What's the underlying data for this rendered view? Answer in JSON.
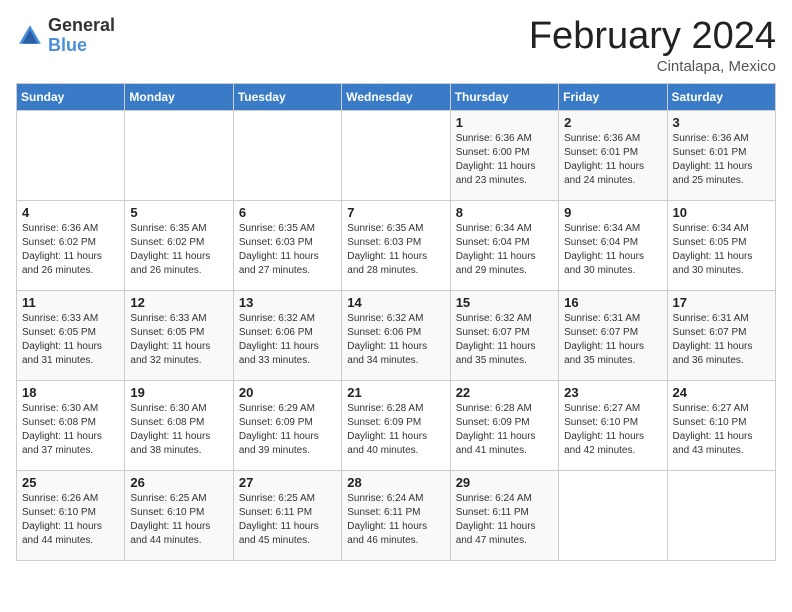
{
  "header": {
    "logo_general": "General",
    "logo_blue": "Blue",
    "month_title": "February 2024",
    "location": "Cintalapa, Mexico"
  },
  "weekdays": [
    "Sunday",
    "Monday",
    "Tuesday",
    "Wednesday",
    "Thursday",
    "Friday",
    "Saturday"
  ],
  "weeks": [
    [
      {
        "day": "",
        "info": ""
      },
      {
        "day": "",
        "info": ""
      },
      {
        "day": "",
        "info": ""
      },
      {
        "day": "",
        "info": ""
      },
      {
        "day": "1",
        "info": "Sunrise: 6:36 AM\nSunset: 6:00 PM\nDaylight: 11 hours\nand 23 minutes."
      },
      {
        "day": "2",
        "info": "Sunrise: 6:36 AM\nSunset: 6:01 PM\nDaylight: 11 hours\nand 24 minutes."
      },
      {
        "day": "3",
        "info": "Sunrise: 6:36 AM\nSunset: 6:01 PM\nDaylight: 11 hours\nand 25 minutes."
      }
    ],
    [
      {
        "day": "4",
        "info": "Sunrise: 6:36 AM\nSunset: 6:02 PM\nDaylight: 11 hours\nand 26 minutes."
      },
      {
        "day": "5",
        "info": "Sunrise: 6:35 AM\nSunset: 6:02 PM\nDaylight: 11 hours\nand 26 minutes."
      },
      {
        "day": "6",
        "info": "Sunrise: 6:35 AM\nSunset: 6:03 PM\nDaylight: 11 hours\nand 27 minutes."
      },
      {
        "day": "7",
        "info": "Sunrise: 6:35 AM\nSunset: 6:03 PM\nDaylight: 11 hours\nand 28 minutes."
      },
      {
        "day": "8",
        "info": "Sunrise: 6:34 AM\nSunset: 6:04 PM\nDaylight: 11 hours\nand 29 minutes."
      },
      {
        "day": "9",
        "info": "Sunrise: 6:34 AM\nSunset: 6:04 PM\nDaylight: 11 hours\nand 30 minutes."
      },
      {
        "day": "10",
        "info": "Sunrise: 6:34 AM\nSunset: 6:05 PM\nDaylight: 11 hours\nand 30 minutes."
      }
    ],
    [
      {
        "day": "11",
        "info": "Sunrise: 6:33 AM\nSunset: 6:05 PM\nDaylight: 11 hours\nand 31 minutes."
      },
      {
        "day": "12",
        "info": "Sunrise: 6:33 AM\nSunset: 6:05 PM\nDaylight: 11 hours\nand 32 minutes."
      },
      {
        "day": "13",
        "info": "Sunrise: 6:32 AM\nSunset: 6:06 PM\nDaylight: 11 hours\nand 33 minutes."
      },
      {
        "day": "14",
        "info": "Sunrise: 6:32 AM\nSunset: 6:06 PM\nDaylight: 11 hours\nand 34 minutes."
      },
      {
        "day": "15",
        "info": "Sunrise: 6:32 AM\nSunset: 6:07 PM\nDaylight: 11 hours\nand 35 minutes."
      },
      {
        "day": "16",
        "info": "Sunrise: 6:31 AM\nSunset: 6:07 PM\nDaylight: 11 hours\nand 35 minutes."
      },
      {
        "day": "17",
        "info": "Sunrise: 6:31 AM\nSunset: 6:07 PM\nDaylight: 11 hours\nand 36 minutes."
      }
    ],
    [
      {
        "day": "18",
        "info": "Sunrise: 6:30 AM\nSunset: 6:08 PM\nDaylight: 11 hours\nand 37 minutes."
      },
      {
        "day": "19",
        "info": "Sunrise: 6:30 AM\nSunset: 6:08 PM\nDaylight: 11 hours\nand 38 minutes."
      },
      {
        "day": "20",
        "info": "Sunrise: 6:29 AM\nSunset: 6:09 PM\nDaylight: 11 hours\nand 39 minutes."
      },
      {
        "day": "21",
        "info": "Sunrise: 6:28 AM\nSunset: 6:09 PM\nDaylight: 11 hours\nand 40 minutes."
      },
      {
        "day": "22",
        "info": "Sunrise: 6:28 AM\nSunset: 6:09 PM\nDaylight: 11 hours\nand 41 minutes."
      },
      {
        "day": "23",
        "info": "Sunrise: 6:27 AM\nSunset: 6:10 PM\nDaylight: 11 hours\nand 42 minutes."
      },
      {
        "day": "24",
        "info": "Sunrise: 6:27 AM\nSunset: 6:10 PM\nDaylight: 11 hours\nand 43 minutes."
      }
    ],
    [
      {
        "day": "25",
        "info": "Sunrise: 6:26 AM\nSunset: 6:10 PM\nDaylight: 11 hours\nand 44 minutes."
      },
      {
        "day": "26",
        "info": "Sunrise: 6:25 AM\nSunset: 6:10 PM\nDaylight: 11 hours\nand 44 minutes."
      },
      {
        "day": "27",
        "info": "Sunrise: 6:25 AM\nSunset: 6:11 PM\nDaylight: 11 hours\nand 45 minutes."
      },
      {
        "day": "28",
        "info": "Sunrise: 6:24 AM\nSunset: 6:11 PM\nDaylight: 11 hours\nand 46 minutes."
      },
      {
        "day": "29",
        "info": "Sunrise: 6:24 AM\nSunset: 6:11 PM\nDaylight: 11 hours\nand 47 minutes."
      },
      {
        "day": "",
        "info": ""
      },
      {
        "day": "",
        "info": ""
      }
    ]
  ]
}
